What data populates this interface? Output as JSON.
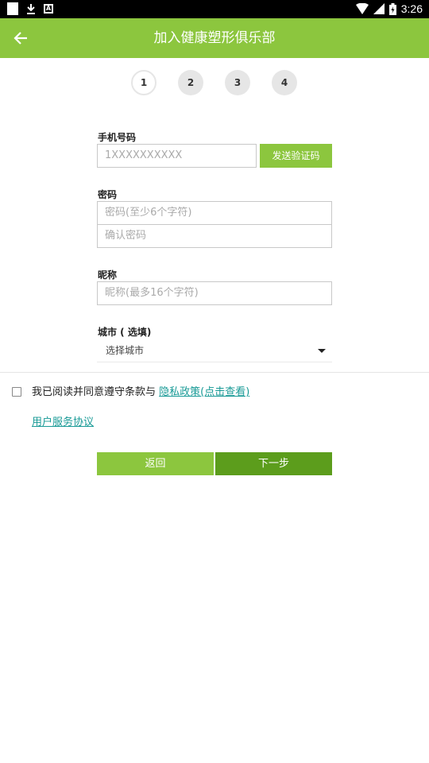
{
  "status_bar": {
    "time": "3:26"
  },
  "toolbar": {
    "title": "加入健康塑形俱乐部"
  },
  "steps": [
    "1",
    "2",
    "3",
    "4"
  ],
  "form": {
    "phone_label": "手机号码",
    "phone_placeholder": "1XXXXXXXXXX",
    "send_code_label": "发送验证码",
    "password_label": "密码",
    "password_placeholder": "密码(至少6个字符)",
    "confirm_placeholder": "确认密码",
    "nickname_label": "昵称",
    "nickname_placeholder": "昵称(最多16个字符)",
    "city_label": "城市 ( 选填)",
    "city_value": "选择城市"
  },
  "agreement": {
    "text": "我已阅读并同意遵守条款与 ",
    "privacy_link": "隐私政策(点击查看)",
    "service_link": "用户服务协议"
  },
  "buttons": {
    "back": "返回",
    "next": "下一步"
  },
  "colors": {
    "brand": "#8cc63e",
    "brand_dark": "#5c9d1c",
    "link": "#189a96"
  }
}
